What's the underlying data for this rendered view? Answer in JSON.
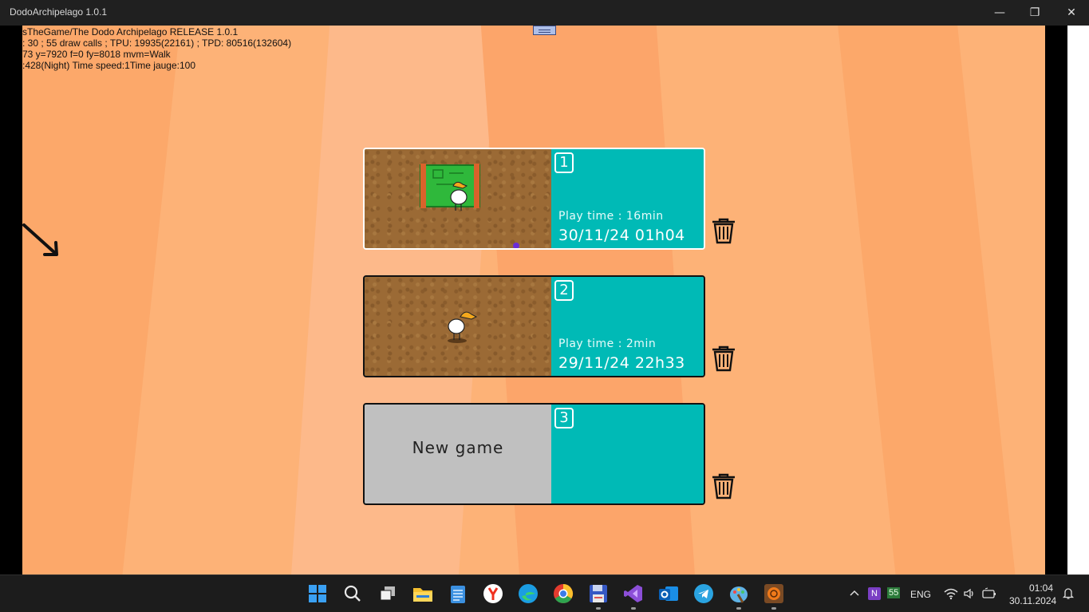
{
  "window": {
    "title": "DodoArchipelago 1.0.1",
    "minimize_glyph": "—",
    "restore_glyph": "❐",
    "close_glyph": "✕"
  },
  "debug": {
    "line1": "sTheGame/The Dodo Archipelago RELEASE 1.0.1",
    "line2": ": 30 ; 55 draw calls ; TPU: 19935(22161) ; TPD: 80516(132604)",
    "line3": "73 y=7920 f=0 fy=8018 mvm=Walk",
    "line4": ":428(Night) Time speed:1Time jauge:100"
  },
  "slots": [
    {
      "number": "1",
      "play_time": "Play time : 16min",
      "date": "30/11/24  01h04",
      "selected": true,
      "thumbnail": "dodo-with-map"
    },
    {
      "number": "2",
      "play_time": "Play time : 2min",
      "date": "29/11/24  22h33",
      "selected": false,
      "thumbnail": "dodo"
    },
    {
      "number": "3",
      "new_game_label": "New game",
      "selected": false,
      "thumbnail": "empty"
    }
  ],
  "taskbar": {
    "apps": [
      "start",
      "search",
      "task-view",
      "file-explorer",
      "notepad",
      "yandex-browser",
      "edge",
      "chrome",
      "save-app",
      "visual-studio",
      "outlook",
      "telegram",
      "paint",
      "dodo-game"
    ],
    "tray": {
      "language": "ENG",
      "onenote_badge": "55",
      "time": "01:04",
      "date": "30.11.2024"
    }
  },
  "colors": {
    "background": "#fdb277",
    "slot_info": "#00bab6",
    "thumbnail_dirt": "#9b6a35",
    "empty_slot": "#c0c0c0"
  }
}
